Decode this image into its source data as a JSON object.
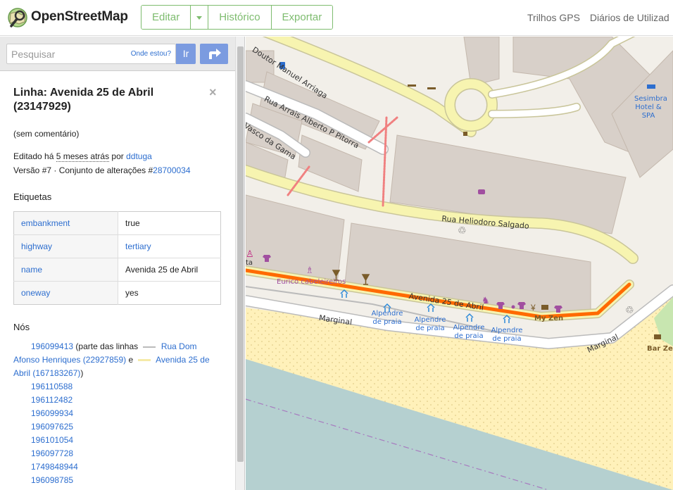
{
  "header": {
    "brand": "OpenStreetMap",
    "edit_label": "Editar",
    "history_label": "Histórico",
    "export_label": "Exportar",
    "gps_traces": "Trilhos GPS",
    "user_diaries": "Diários de Utilizad"
  },
  "search": {
    "placeholder": "Pesquisar",
    "where_am_i": "Onde estou?",
    "go_label": "Ir"
  },
  "feature": {
    "title": "Linha: Avenida 25 de Abril (23147929)",
    "comment": "(sem comentário)",
    "edited_prefix": "Editado há ",
    "edited_time": "5 meses atrás",
    "edited_by": " por ",
    "user": "ddtuga",
    "version_prefix": "Versão #7 · Conjunto de alterações #",
    "changeset": "28700034"
  },
  "tags_heading": "Etiquetas",
  "tags": [
    {
      "key": "embankment",
      "value": "true",
      "value_link": false
    },
    {
      "key": "highway",
      "value": "tertiary",
      "value_link": true
    },
    {
      "key": "name",
      "value": "Avenida 25 de Abril",
      "value_link": false
    },
    {
      "key": "oneway",
      "value": "yes",
      "value_link": false
    }
  ],
  "nodes_heading": "Nós",
  "nodes": {
    "first_node": "196099413",
    "part_of": " (parte das linhas ",
    "way1": "Rua Dom Afonso Henriques (22927859)",
    "and": " e ",
    "way2": "Avenida 25 de Abril (167183267)",
    "close": ")",
    "list": [
      "196110588",
      "196112482",
      "196099934",
      "196097625",
      "196101054",
      "196097728",
      "1749848944",
      "196098785"
    ]
  },
  "map": {
    "labels": {
      "rua_doutor": "Doutor Manuel Arriaga",
      "rua_arrais": "Rua Arrais Alberto P Pitorra",
      "vasco": "Vasco da Gama",
      "heliodoro": "Rua Heliodoro Salgado",
      "avenida": "Avenida 25 de Abril",
      "marginal1": "Marginal",
      "marginal2": "Marginal",
      "hotel": "Sesimbra Hotel & SPA",
      "cabeleireiros": "Eurico cabeleireiros",
      "alpendre1": "Alpendre de praia",
      "alpendre2": "Alpendre de praia",
      "alpendre3": "Alpendre de praia",
      "alpendre4": "Alpendre de praia",
      "my_zen": "My Zen",
      "bar_ze": "Bar Ze",
      "ta": "ta"
    },
    "colors": {
      "selected_way": "#ff6a00",
      "road": "#f7f4b0",
      "building": "#d8d0c9",
      "water": "#b5d0d0",
      "beach": "#fff1ba",
      "link": "#2d6ecf",
      "brand_green": "#7ebc6f"
    }
  }
}
